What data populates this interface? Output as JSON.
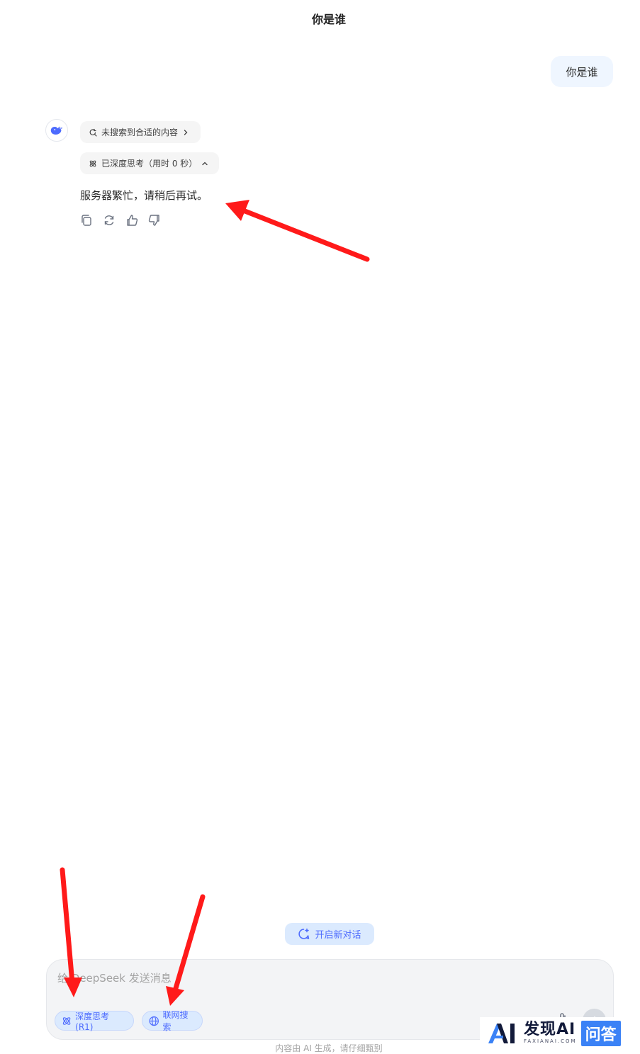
{
  "header": {
    "title": "你是谁"
  },
  "conversation": {
    "user_message": "你是谁",
    "search_status": "未搜索到合适的内容",
    "think_status": "已深度思考（用时 0 秒）",
    "answer": "服务器繁忙，请稍后再试。"
  },
  "new_chat_label": "开启新对话",
  "composer": {
    "placeholder": "给 DeepSeek 发送消息",
    "deep_think_label": "深度思考 (R1)",
    "web_search_label": "联网搜索"
  },
  "footer_note": "内容由 AI 生成，请仔细甄别",
  "watermark": {
    "brand": "发现AI",
    "sub": "FAXIANAI.COM",
    "tag": "问答"
  },
  "colors": {
    "accent": "#4d6bfe",
    "annotation_arrow": "#ff1a1a",
    "user_bubble": "#eff6ff",
    "composer_bg": "#f3f4f6"
  }
}
